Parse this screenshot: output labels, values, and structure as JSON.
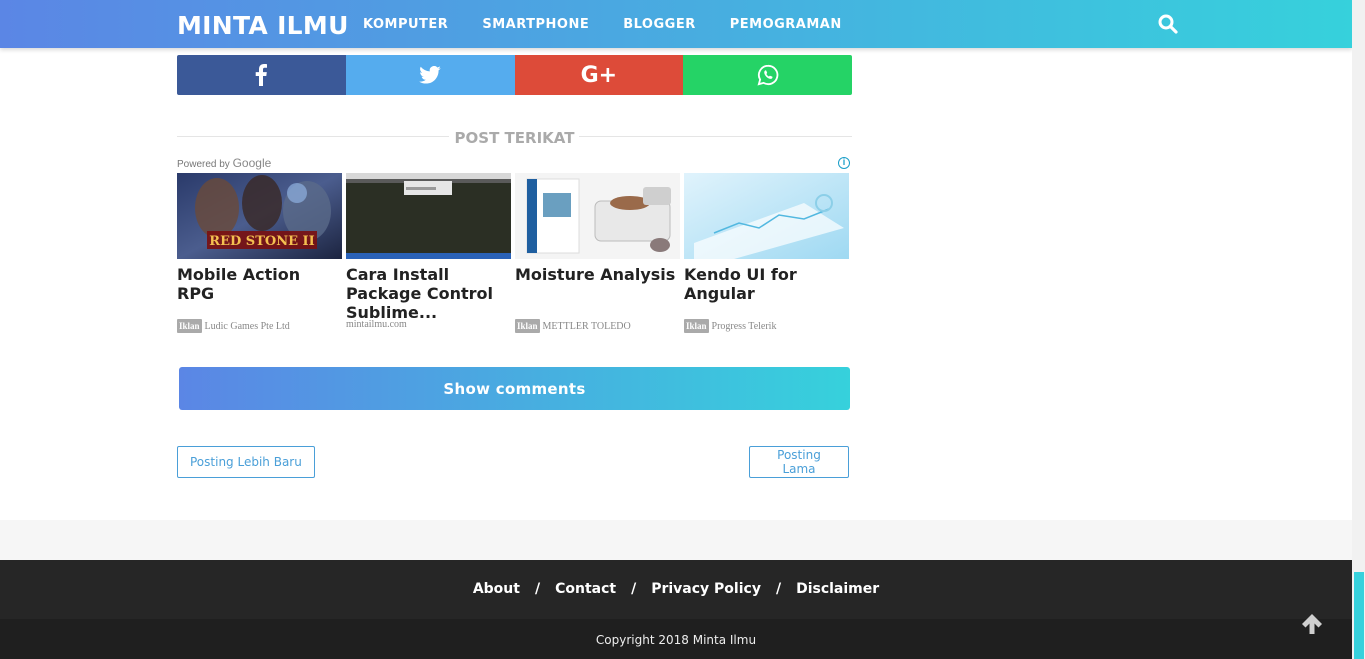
{
  "header": {
    "logo": "MINTA ILMU",
    "nav": [
      "KOMPUTER",
      "SMARTPHONE",
      "BLOGGER",
      "PEMOGRAMAN"
    ]
  },
  "share": {
    "gplus_label": "G+"
  },
  "related": {
    "title": "POST TERIKAT",
    "powered_prefix": "Powered by ",
    "powered_brand": "Google",
    "info": "i"
  },
  "ads": [
    {
      "title": "Mobile Action RPG",
      "badge": "Iklan",
      "source": "Ludic Games Pte Ltd",
      "thumb_text": "RED STONE II"
    },
    {
      "title": "Cara Install Package Control Sublime...",
      "badge": "",
      "source": "mintailmu.com"
    },
    {
      "title": "Moisture Analysis",
      "badge": "Iklan",
      "source": "METTLER TOLEDO"
    },
    {
      "title": "Kendo UI for Angular",
      "badge": "Iklan",
      "source": "Progress Telerik"
    }
  ],
  "comments_button": "Show comments",
  "pager": {
    "newer": "Posting Lebih Baru",
    "older": "Posting Lama"
  },
  "footer": {
    "links": [
      "About",
      "Contact",
      "Privacy Policy",
      "Disclaimer"
    ],
    "separator": "/",
    "copyright": "Copyright 2018 Minta Ilmu"
  },
  "colors": {
    "gradient_start": "#5b86e5",
    "gradient_end": "#36d1dc",
    "facebook": "#3b5998",
    "twitter": "#55acee",
    "gplus": "#dd4b39",
    "whatsapp": "#25d366"
  }
}
